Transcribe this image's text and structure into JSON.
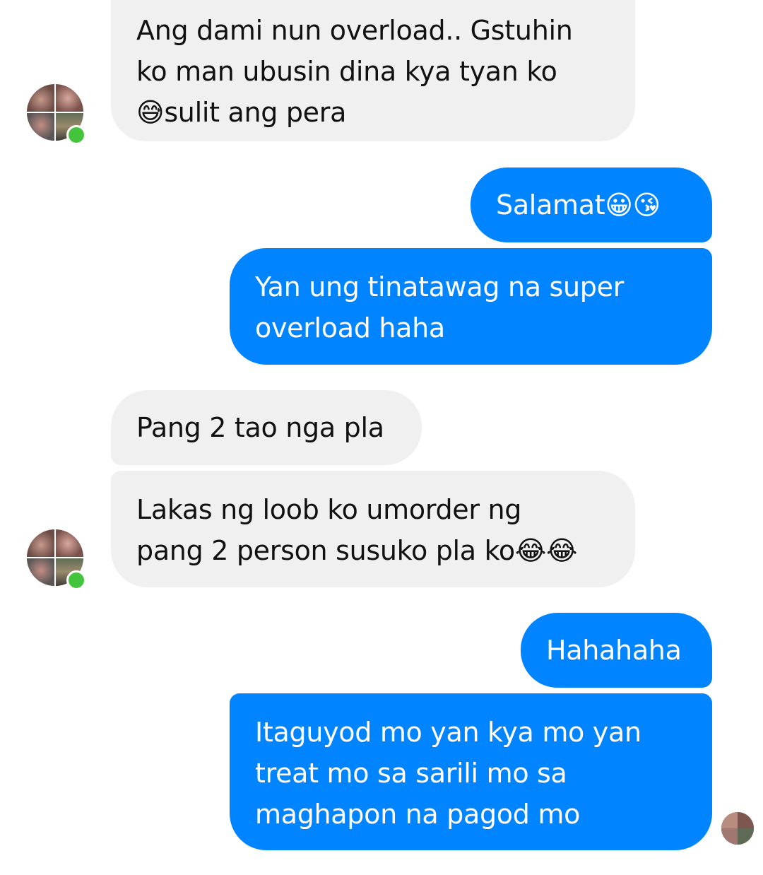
{
  "conversation": {
    "messages": [
      {
        "direction": "incoming",
        "text": "Ang dami nun overload.. Gstuhin\nko man ubusin dina kya tyan ko\n😅sulit ang pera"
      },
      {
        "direction": "outgoing",
        "text": "Salamat😀😘"
      },
      {
        "direction": "outgoing",
        "text": "Yan ung tinatawag na super\noverload haha"
      },
      {
        "direction": "incoming",
        "text": "Pang 2 tao nga pla"
      },
      {
        "direction": "incoming",
        "text": "Lakas ng loob ko umorder ng\npang 2 person susuko pla ko😂😂"
      },
      {
        "direction": "outgoing",
        "text": "Hahahaha"
      },
      {
        "direction": "outgoing",
        "text": "Itaguyod mo yan kya mo yan\ntreat mo sa sarili mo sa\nmaghapon na pagod mo"
      }
    ]
  },
  "colors": {
    "outgoing_bubble": "#0084ff",
    "incoming_bubble": "#f0f0f0",
    "online_indicator": "#44c33d"
  },
  "icons": {
    "contact_avatar": "contact-avatar-icon",
    "online_status": "online-status-icon",
    "seen_indicator": "seen-avatar-icon"
  }
}
